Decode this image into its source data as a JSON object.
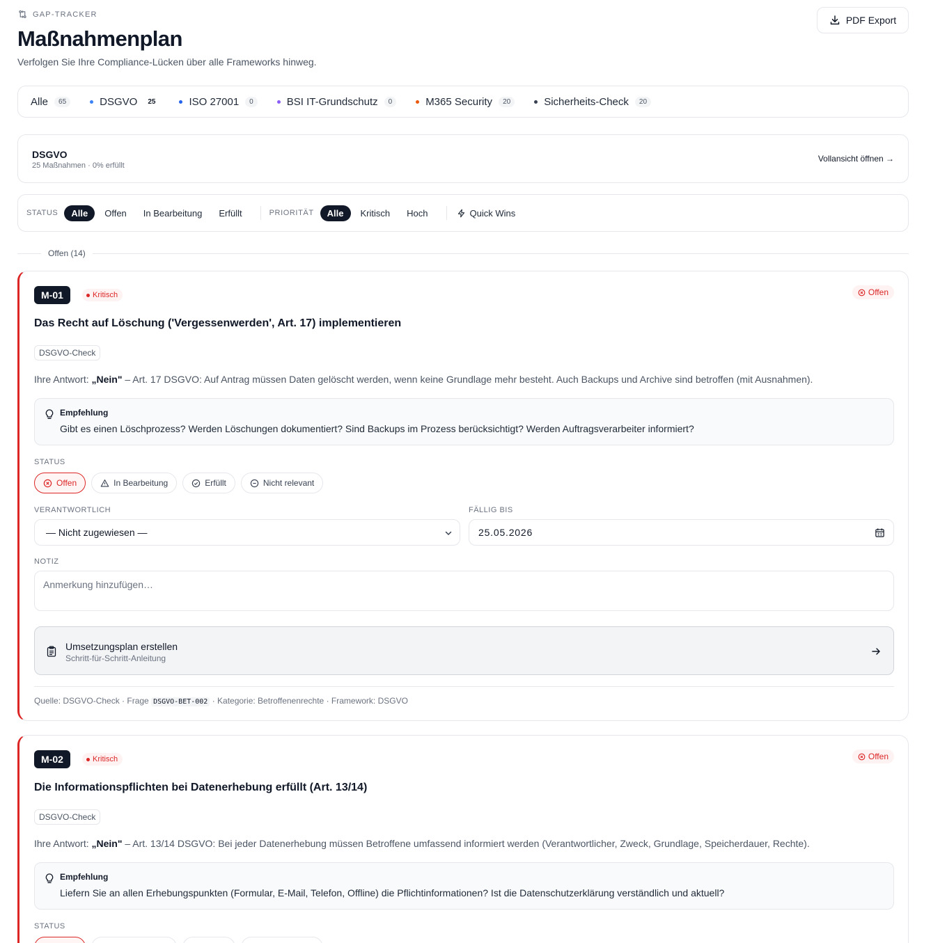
{
  "header": {
    "eyebrow": "GAP-TRACKER",
    "title": "Maßnahmenplan",
    "subtitle": "Verfolgen Sie Ihre Compliance-Lücken über alle Frameworks hinweg.",
    "pdf_label": "PDF Export"
  },
  "frameworks": [
    {
      "label": "Alle",
      "count": "65",
      "color": ""
    },
    {
      "label": "DSGVO",
      "count": "25",
      "color": "#3b82f6"
    },
    {
      "label": "ISO 27001",
      "count": "0",
      "color": "#2563eb"
    },
    {
      "label": "BSI IT-Grundschutz",
      "count": "0",
      "color": "#8b5cf6"
    },
    {
      "label": "M365 Security",
      "count": "20",
      "color": "#ea580c"
    },
    {
      "label": "Sicherheits-Check",
      "count": "20",
      "color": "#374151"
    }
  ],
  "summary": {
    "title": "DSGVO",
    "subtitle": "25 Maßnahmen · 0% erfüllt",
    "link": "Vollansicht öffnen →"
  },
  "filters": {
    "status_label": "STATUS",
    "status_options": [
      "Alle",
      "Offen",
      "In Bearbeitung",
      "Erfüllt"
    ],
    "priority_label": "PRIORITÄT",
    "priority_options": [
      "Alle",
      "Kritisch",
      "Hoch"
    ],
    "quick_wins": "Quick Wins"
  },
  "section": {
    "label": "Offen (14)"
  },
  "labels": {
    "answer_prefix": "Ihre Antwort:",
    "recommendation": "Empfehlung",
    "status": "STATUS",
    "owner": "VERANTWORTLICH",
    "due": "FÄLLIG BIS",
    "note": "NOTIZ",
    "status_options": [
      "Offen",
      "In Bearbeitung",
      "Erfüllt",
      "Nicht relevant"
    ],
    "plan_title": "Umsetzungsplan erstellen",
    "plan_sub": "Schritt-für-Schritt-Anleitung"
  },
  "cards": [
    {
      "id": "M-01",
      "priority": "Kritisch",
      "status": "Offen",
      "title": "Das Recht auf Löschung ('Vergessenwerden', Art. 17) implementieren",
      "tag": "DSGVO-Check",
      "answer": "„Nein\"",
      "answer_text": " – Art. 17 DSGVO: Auf Antrag müssen Daten gelöscht werden, wenn keine Grundlage mehr besteht. Auch Backups und Archive sind betroffen (mit Ausnahmen).",
      "recommendation": "Gibt es einen Löschprozess? Werden Löschungen dokumentiert? Sind Backups im Prozess berücksichtigt? Werden Auftragsverarbeiter informiert?",
      "owner": "— Nicht zugewiesen —",
      "due": "25.05.2026",
      "note_placeholder": "Anmerkung hinzufügen…",
      "source_prefix": "Quelle: DSGVO-Check · Frage",
      "source_code": "DSGVO-BET-002",
      "source_suffix": "· Kategorie: Betroffenenrechte · Framework: DSGVO"
    },
    {
      "id": "M-02",
      "priority": "Kritisch",
      "status": "Offen",
      "title": "Die Informationspflichten bei Datenerhebung erfüllt (Art. 13/14)",
      "tag": "DSGVO-Check",
      "answer": "„Nein\"",
      "answer_text": " – Art. 13/14 DSGVO: Bei jeder Datenerhebung müssen Betroffene umfassend informiert werden (Verantwortlicher, Zweck, Grundlage, Speicherdauer, Rechte).",
      "recommendation": "Liefern Sie an allen Erhebungspunkten (Formular, E-Mail, Telefon, Offline) die Pflichtinformationen? Ist die Datenschutzerklärung verständlich und aktuell?"
    }
  ]
}
